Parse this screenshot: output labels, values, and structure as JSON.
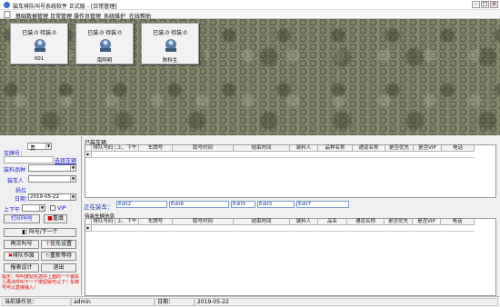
{
  "window": {
    "title": "装车排队叫号系统软件 正式版 - [日常管理]"
  },
  "menu": [
    "基础数据管理",
    "日常管理",
    "操作员管理",
    "系统维护",
    "在线帮助"
  ],
  "cards": [
    {
      "status": "已装:0 待装:0",
      "name": "001"
    },
    {
      "status": "已装:0 待装:0",
      "name": "南阿明"
    },
    {
      "status": "已装:0 待装:0",
      "name": "陈科生"
    }
  ],
  "left_panel": {
    "plate_label": "车牌号：",
    "plate_value": "贵",
    "select_plate_link": "选择车辆",
    "variety_label": "装料品种",
    "loader_label": "装车人",
    "position_label": "蚂位",
    "date_label": "日期：",
    "date_value": "2019-05-22",
    "ampm_label": "上下午",
    "vip_label": "VIP",
    "print_button": "打印叫号",
    "clear_button": "重填",
    "call_next_button": "叫号/下一个",
    "call_again_button": "再次叫号",
    "priority_button": "优先设置",
    "cancel_queue_button": "排队作废",
    "requeue_button": "重新等待",
    "report_button": "报表设计",
    "exit_button": "退出",
    "hint": "提示：呼叫按钮先选中上面的一个装车人再点呼叫下一个按钮就可以了！车牌号可以直接输入！"
  },
  "loaded_grid": {
    "caption": "已装车辆",
    "columns": [
      "排队号码",
      "上、下午",
      "车牌号",
      "取号时间",
      "结束时间",
      "装料人",
      "品种名称",
      "通道名称",
      "是否优先",
      "是否VIP",
      "电话"
    ]
  },
  "loading_row": {
    "label": "正在装车：",
    "edits": [
      "Edit2",
      "Edit6",
      "Edit5",
      "Edit3",
      "Edit7"
    ]
  },
  "waiting_grid": {
    "caption": "待装车辆信息",
    "columns": [
      "排队号码",
      "上、下午",
      "车牌号",
      "取号时间",
      "结束时间",
      "装料人",
      "品名",
      "通道名称",
      "是否优先",
      "是否VIP",
      "电话"
    ]
  },
  "status": {
    "operator_label": "当前操作员：",
    "operator": "admin",
    "date_label": "日期：",
    "date": "2019-05-22"
  }
}
